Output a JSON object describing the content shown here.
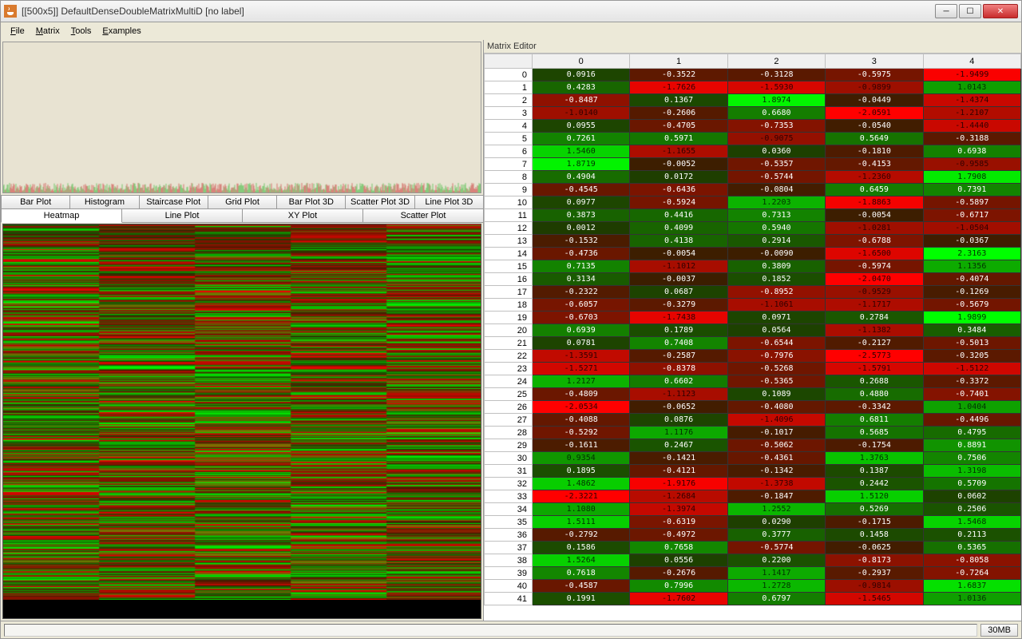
{
  "window": {
    "title": "[[500x5]] DefaultDenseDoubleMatrixMultiD [no label]"
  },
  "menu": {
    "file": "File",
    "matrix": "Matrix",
    "tools": "Tools",
    "examples": "Examples"
  },
  "tabs_row1": [
    "Bar Plot",
    "Histogram",
    "Staircase Plot",
    "Grid Plot",
    "Bar Plot 3D",
    "Scatter Plot 3D",
    "Line Plot 3D"
  ],
  "tabs_row2": [
    "Heatmap",
    "Line Plot",
    "XY Plot",
    "Scatter Plot"
  ],
  "active_tab": "Heatmap",
  "editor_label": "Matrix Editor",
  "col_headers": [
    "0",
    "1",
    "2",
    "3",
    "4"
  ],
  "status": {
    "mem": "30MB"
  },
  "chart_data": {
    "type": "heatmap",
    "title": "",
    "rows_total": 500,
    "cols": 5,
    "colormap": "red-black-green (negative→positive)",
    "value_range": [
      -2.5,
      2.5
    ],
    "visible_rows": [
      {
        "i": 0,
        "v": [
          0.0916,
          -0.3522,
          -0.3128,
          -0.5975,
          -1.9499
        ]
      },
      {
        "i": 1,
        "v": [
          0.4283,
          -1.7626,
          -1.593,
          -0.9899,
          1.0143
        ]
      },
      {
        "i": 2,
        "v": [
          -0.8487,
          0.1367,
          1.8974,
          -0.0449,
          -1.4374
        ]
      },
      {
        "i": 3,
        "v": [
          -1.014,
          -0.2606,
          0.668,
          -2.0591,
          -1.2107
        ]
      },
      {
        "i": 4,
        "v": [
          0.0955,
          -0.4705,
          -0.7353,
          -0.054,
          -1.444
        ]
      },
      {
        "i": 5,
        "v": [
          0.7261,
          0.5971,
          -0.9075,
          0.5649,
          -0.3188
        ]
      },
      {
        "i": 6,
        "v": [
          1.546,
          -1.1655,
          0.036,
          -0.181,
          0.6938
        ]
      },
      {
        "i": 7,
        "v": [
          1.8719,
          -0.0052,
          -0.5357,
          -0.4153,
          -0.9585
        ]
      },
      {
        "i": 8,
        "v": [
          0.4904,
          0.0172,
          -0.5744,
          -1.236,
          1.7908
        ]
      },
      {
        "i": 9,
        "v": [
          -0.4545,
          -0.6436,
          -0.0804,
          0.6459,
          0.7391
        ]
      },
      {
        "i": 10,
        "v": [
          0.0977,
          -0.5924,
          1.2203,
          -1.8863,
          -0.5897
        ]
      },
      {
        "i": 11,
        "v": [
          0.3873,
          0.4416,
          0.7313,
          -0.0054,
          -0.6717
        ]
      },
      {
        "i": 12,
        "v": [
          0.0012,
          0.4099,
          0.594,
          -1.0281,
          -1.0504
        ]
      },
      {
        "i": 13,
        "v": [
          -0.1532,
          0.4138,
          0.2914,
          -0.6788,
          -0.0367
        ]
      },
      {
        "i": 14,
        "v": [
          -0.4736,
          -0.0054,
          -0.009,
          -1.65,
          2.3163
        ]
      },
      {
        "i": 15,
        "v": [
          0.7135,
          -1.1012,
          0.3809,
          -0.5974,
          1.1356
        ]
      },
      {
        "i": 16,
        "v": [
          0.3134,
          -0.0037,
          0.1852,
          -2.047,
          -0.4074
        ]
      },
      {
        "i": 17,
        "v": [
          -0.2322,
          0.0687,
          -0.8952,
          -0.9529,
          -0.1269
        ]
      },
      {
        "i": 18,
        "v": [
          -0.6057,
          -0.3279,
          -1.1061,
          -1.1717,
          -0.5679
        ]
      },
      {
        "i": 19,
        "v": [
          -0.6703,
          -1.7438,
          0.0971,
          0.2784,
          1.9899
        ]
      },
      {
        "i": 20,
        "v": [
          0.6939,
          0.1789,
          0.0564,
          -1.1382,
          0.3484
        ]
      },
      {
        "i": 21,
        "v": [
          0.0781,
          0.7408,
          -0.6544,
          -0.2127,
          -0.5013
        ]
      },
      {
        "i": 22,
        "v": [
          -1.3591,
          -0.2587,
          -0.7976,
          -2.5773,
          -0.3205
        ]
      },
      {
        "i": 23,
        "v": [
          -1.5271,
          -0.8378,
          -0.5268,
          -1.5791,
          -1.5122
        ]
      },
      {
        "i": 24,
        "v": [
          1.2127,
          0.6602,
          -0.5365,
          0.2688,
          -0.3372
        ]
      },
      {
        "i": 25,
        "v": [
          -0.4809,
          -1.1123,
          0.1089,
          0.488,
          -0.7401
        ]
      },
      {
        "i": 26,
        "v": [
          -2.0534,
          -0.0652,
          -0.408,
          -0.3342,
          1.0404
        ]
      },
      {
        "i": 27,
        "v": [
          -0.4088,
          0.0876,
          -1.4096,
          0.6811,
          -0.4496
        ]
      },
      {
        "i": 28,
        "v": [
          -0.5292,
          1.1176,
          -0.1017,
          0.5685,
          0.4795
        ]
      },
      {
        "i": 29,
        "v": [
          -0.1611,
          0.2467,
          -0.5062,
          -0.1754,
          0.8891
        ]
      },
      {
        "i": 30,
        "v": [
          0.9354,
          -0.1421,
          -0.4361,
          1.3763,
          0.7506
        ]
      },
      {
        "i": 31,
        "v": [
          0.1895,
          -0.4121,
          -0.1342,
          0.1387,
          1.3198
        ]
      },
      {
        "i": 32,
        "v": [
          1.4862,
          -1.9176,
          -1.3738,
          0.2442,
          0.5709
        ]
      },
      {
        "i": 33,
        "v": [
          -2.3221,
          -1.2684,
          -0.1847,
          1.512,
          0.0602
        ]
      },
      {
        "i": 34,
        "v": [
          1.108,
          -1.3974,
          1.2552,
          0.5269,
          0.2506
        ]
      },
      {
        "i": 35,
        "v": [
          1.5111,
          -0.6319,
          0.029,
          -0.1715,
          1.5468
        ]
      },
      {
        "i": 36,
        "v": [
          -0.2792,
          -0.4972,
          0.3777,
          0.1458,
          0.2113
        ]
      },
      {
        "i": 37,
        "v": [
          0.1586,
          0.7658,
          -0.5774,
          -0.0625,
          0.5365
        ]
      },
      {
        "i": 38,
        "v": [
          1.5264,
          0.0556,
          0.22,
          -0.8173,
          -0.8058
        ]
      },
      {
        "i": 39,
        "v": [
          0.7618,
          -0.2676,
          1.1417,
          -0.2937,
          -0.7264
        ]
      },
      {
        "i": 40,
        "v": [
          -0.4587,
          0.7996,
          1.2728,
          -0.9814,
          1.6837
        ]
      },
      {
        "i": 41,
        "v": [
          0.1991,
          -1.7602,
          0.6797,
          -1.5465,
          1.0136
        ]
      }
    ]
  }
}
